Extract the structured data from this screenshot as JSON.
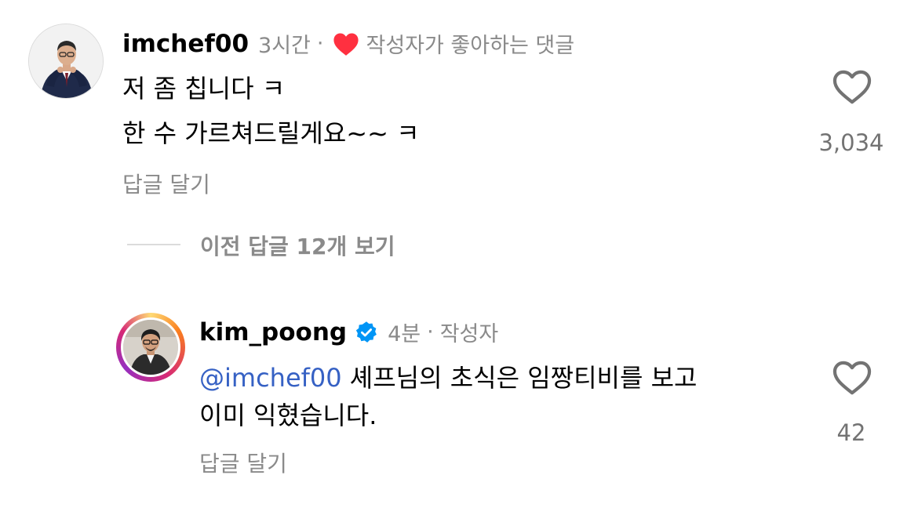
{
  "comments": [
    {
      "username": "imchef00",
      "time": "3시간",
      "creator_liked_label": "작성자가 좋아하는 댓글",
      "lines": [
        "저 좀 칩니다 ㅋ",
        "한 수 가르쳐드릴게요~~ ㅋ"
      ],
      "reply_label": "답글 달기",
      "like_count": "3,034",
      "icons": {
        "heart": "heart-outline-icon",
        "creator_heart": "red-heart-icon"
      }
    },
    {
      "username": "kim_poong",
      "verified": true,
      "time": "4분",
      "author_label": "작성자",
      "mention": "@imchef00",
      "line1_rest": " 셰프님의 초식은 임짱티비를 보고",
      "line2": "이미 익혔습니다.",
      "reply_label": "답글 달기",
      "like_count": "42",
      "icons": {
        "heart": "heart-outline-icon",
        "verified": "verified-badge-icon"
      }
    }
  ],
  "view_previous_replies": "이전 답글 12개 보기",
  "colors": {
    "mention": "#3661c4",
    "verified": "#0095f6",
    "creator_heart": "#ff3040",
    "meta_gray": "#8a8a8a"
  }
}
